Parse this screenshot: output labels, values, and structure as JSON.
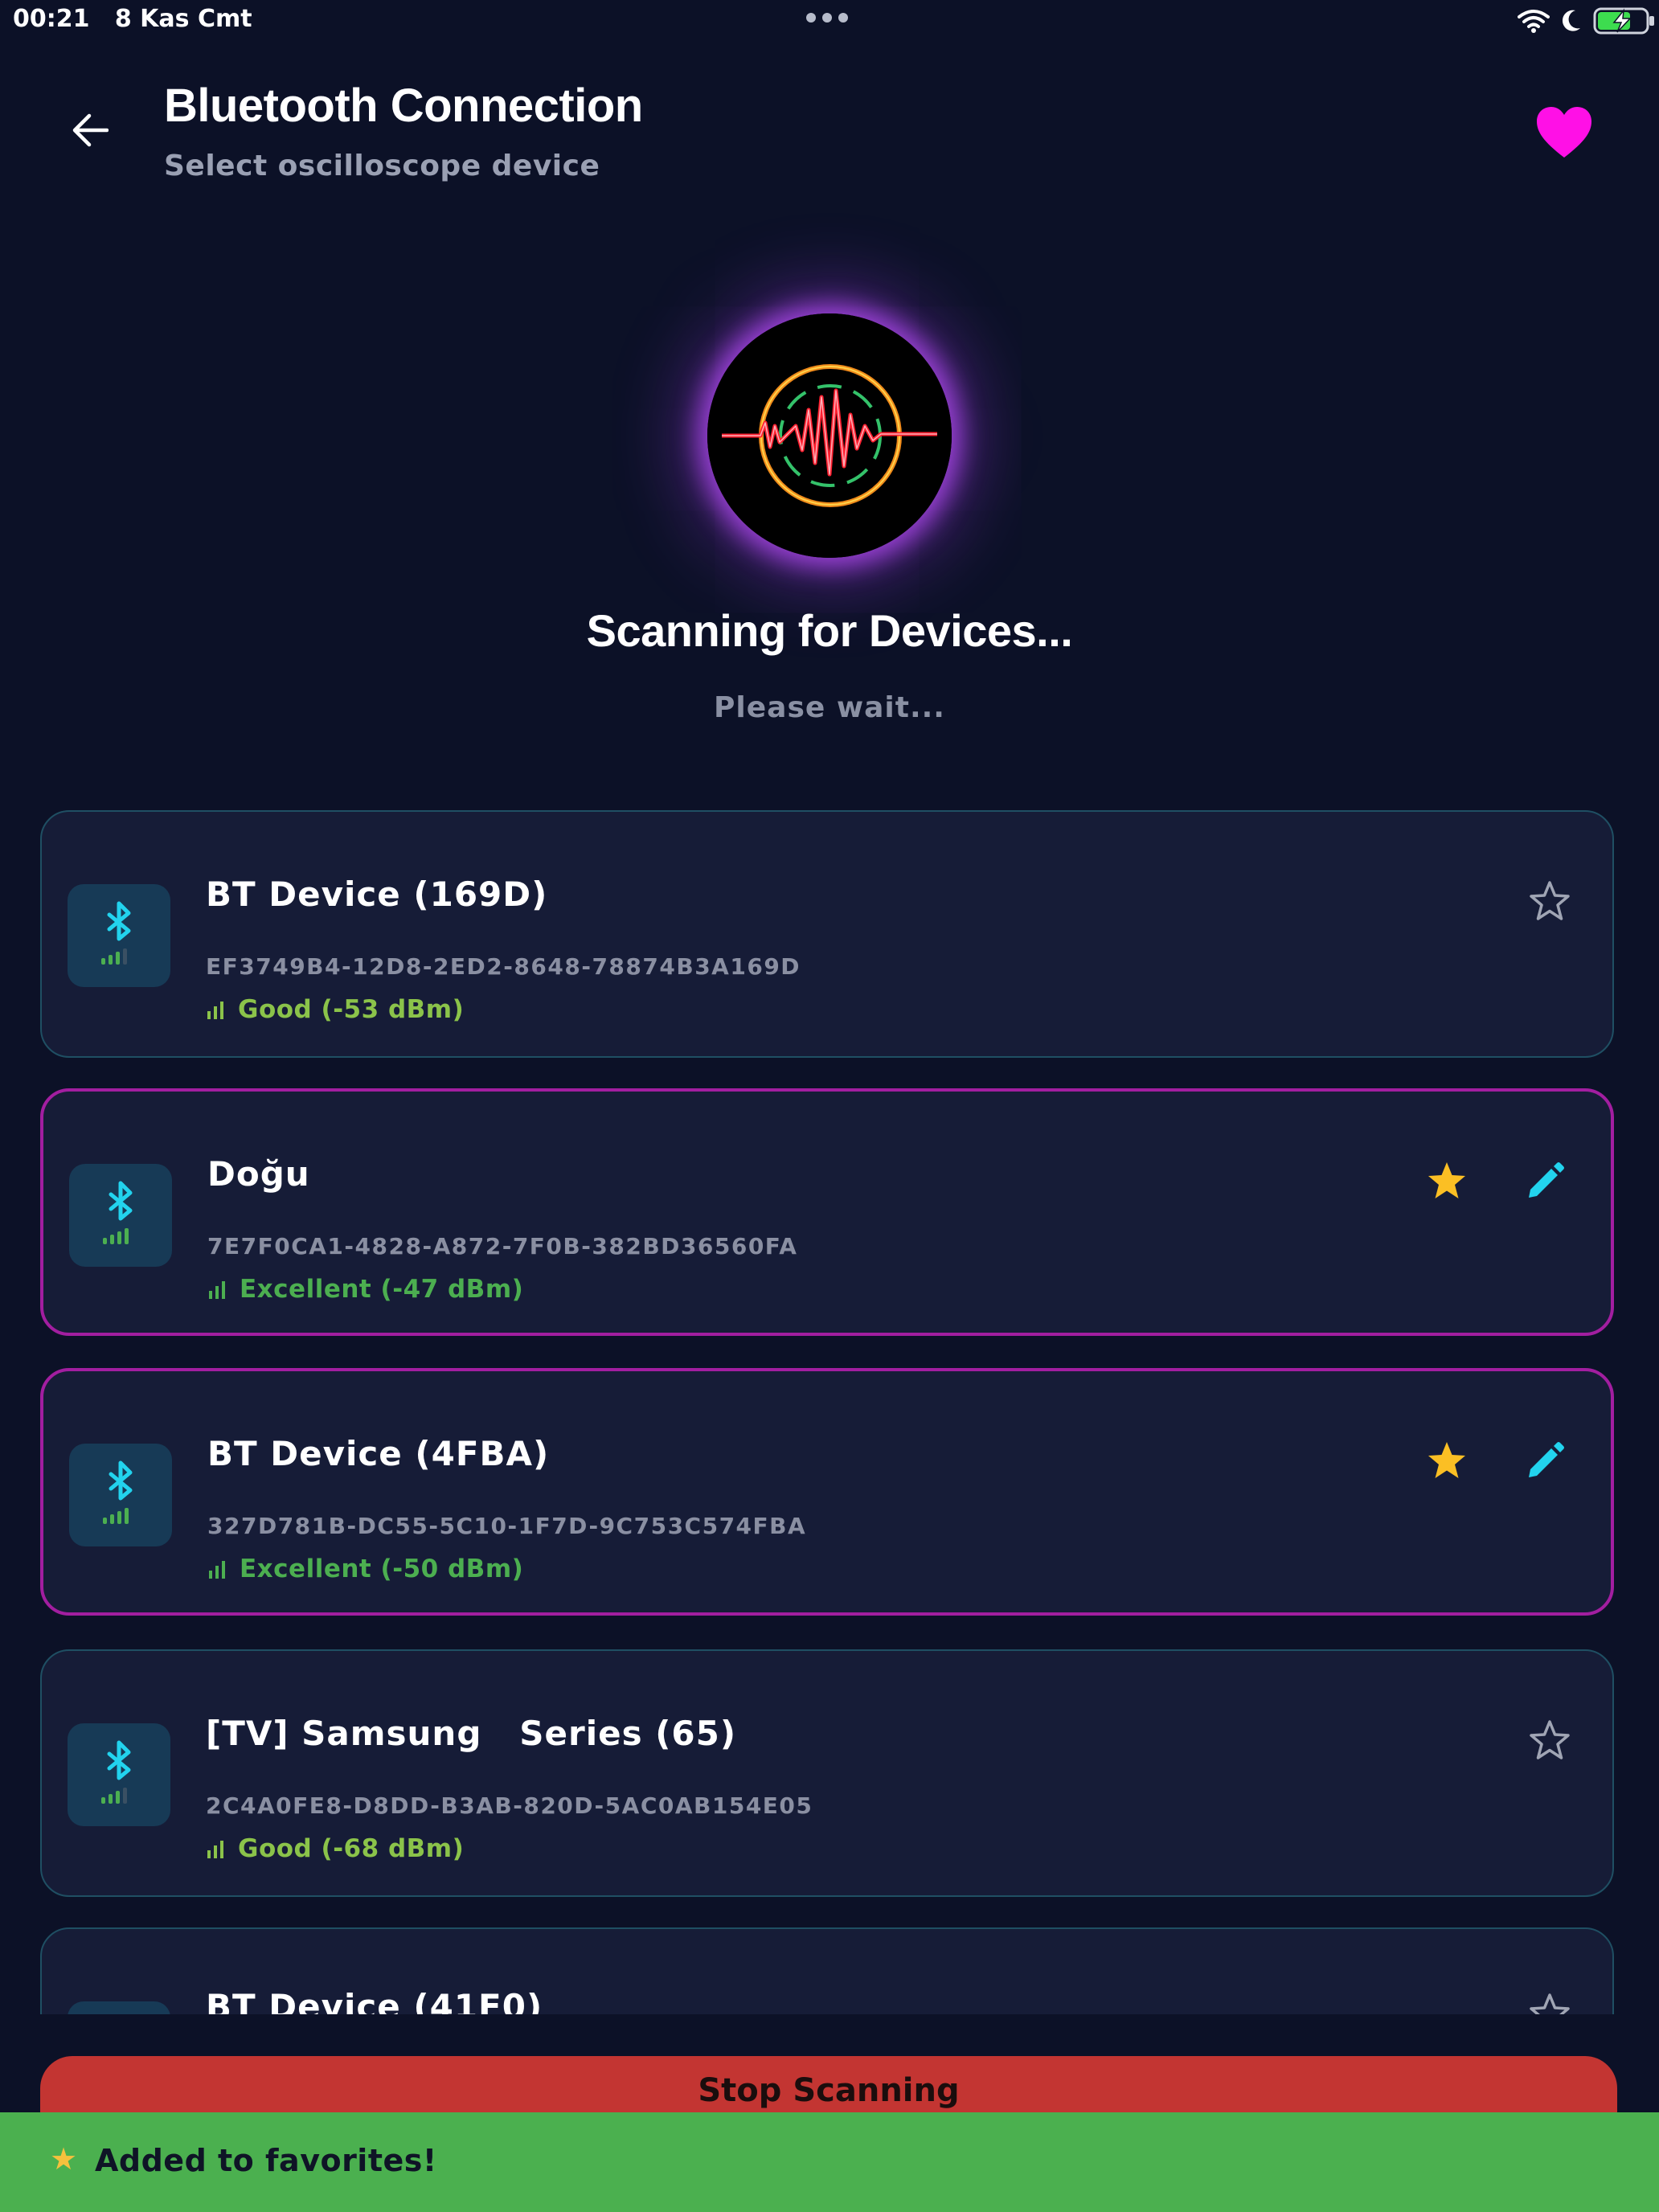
{
  "status_bar": {
    "time": "00:21",
    "date": "8 Kas Cmt",
    "icons": [
      "wifi-icon",
      "moon-icon",
      "battery-charging-icon"
    ]
  },
  "header": {
    "title": "Bluetooth Connection",
    "subtitle": "Select oscilloscope device",
    "back_icon": "arrow-left-icon",
    "favorite_icon": "heart-icon",
    "favorite_color": "#ff10e6"
  },
  "scan": {
    "logo_icon": "oscilloscope-wave-logo",
    "title": "Scanning for Devices...",
    "subtitle": "Please wait..."
  },
  "devices": [
    {
      "name": "BT Device (169D)",
      "uuid": "EF3749B4-12D8-2ED2-8648-78874B3A169D",
      "signal_text": "Good (-53 dBm)",
      "signal_color": "#8bc34a",
      "favorite": false,
      "editable": false
    },
    {
      "name": "Doğu",
      "uuid": "7E7F0CA1-4828-A872-7F0B-382BD36560FA",
      "signal_text": "Excellent (-47 dBm)",
      "signal_color": "#4caf50",
      "favorite": true,
      "editable": true
    },
    {
      "name": "BT Device (4FBA)",
      "uuid": "327D781B-DC55-5C10-1F7D-9C753C574FBA",
      "signal_text": "Excellent (-50 dBm)",
      "signal_color": "#4caf50",
      "favorite": true,
      "editable": true
    },
    {
      "name": "[TV] Samsung   Series (65)",
      "uuid": "2C4A0FE8-D8DD-B3AB-820D-5AC0AB154E05",
      "signal_text": "Good (-68 dBm)",
      "signal_color": "#8bc34a",
      "favorite": false,
      "editable": false
    },
    {
      "name": "BT Device (41F0)",
      "uuid": "",
      "signal_text": "",
      "signal_color": "#8bc34a",
      "favorite": false,
      "editable": false
    }
  ],
  "stop_button": {
    "label": "Stop Scanning",
    "color": "#c33532"
  },
  "toast": {
    "icon": "star-emoji",
    "text": "Added to favorites!",
    "color": "#4bb04f"
  },
  "colors": {
    "background": "#0c1127",
    "card": "#161c37",
    "accent_cyan": "#22d3ee",
    "favorite_border": "#a21ea0",
    "star_gold": "#fbbf24"
  }
}
